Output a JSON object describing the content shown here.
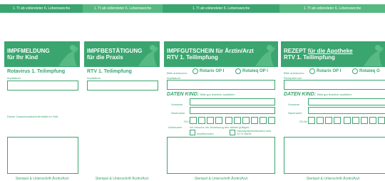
{
  "colors": {
    "green": "#3aa56f",
    "light_green": "#56b981",
    "white": "#ffffff"
  },
  "top_labels": [
    "1. Tt ab vollendeter 6. Lebenswoche",
    "1. Tt ab vollendeter 6. Lebenswoche",
    "1. Tt ab vollendeter 6. Lebenswoche",
    "1. Tt ab vollendeter 6. Lebenswoche"
  ],
  "col1": {
    "title1": "IMPFMELDUNG",
    "title2": "für Ihr Kind",
    "sub": "Rotavirus 1. Teilimpfung",
    "date_label": "Impfdatum",
    "note": "Dieser Gutscheinabschnitt bleibt im Heft.",
    "footer": "Stempel & Unterschrift Ärztin/Arzt"
  },
  "col2": {
    "title1": "IMPFBESTÄTIGUNG",
    "title2": "für die Praxis",
    "sub": "RTV 1. Teilimpfung",
    "date_label": "Impfdatum",
    "footer": "Stempel & Unterschrift Ärztin/Arzt"
  },
  "col3": {
    "title1": "IMPFGUTSCHEIN für Ärztin/Arzt",
    "title2": "RTV 1. Teilimpfung",
    "choose": "Bitte ankreuzen:",
    "opt1": "Rotarix OP I",
    "opt2": "Rotateq OP I",
    "date_label": "Impfdatum",
    "kind": "DATEN KIND:",
    "kind_hint": "Bitte gut leserlich ausfüllen!",
    "vorname": "Vorname",
    "nachname": "Nachname",
    "svnr": "SV-Nr.",
    "ankreuzen": "Ankreuzen:",
    "note": "Ich ersuche um Anweisung des aktuell gültigen...",
    "impfhonorar": "Impfhonorars",
    "haus": "Hausapothekenkosten exkl. 10 % MwSt.",
    "footer": "Stempel & Unterschrift Ärztin/Arzt"
  },
  "col4": {
    "title1_prefix": "REZEPT",
    "title1_link": "für die Apotheke",
    "title2": "RTV 1. Teilimpfung",
    "choose": "Bitte ankreuzen:",
    "opt1": "Rotarix OP I",
    "opt2": "Rotateq O",
    "date_label": "Rezeptiert am",
    "kind": "DATEN KIND:",
    "kind_hint": "Bitte gut leserlich ausfüllen!",
    "vorname": "Vorname",
    "nachname": "Nachname",
    "svnr": "SV-Nr.",
    "footer": "Stempel & Unterschrift Ärztin/Arzt"
  }
}
